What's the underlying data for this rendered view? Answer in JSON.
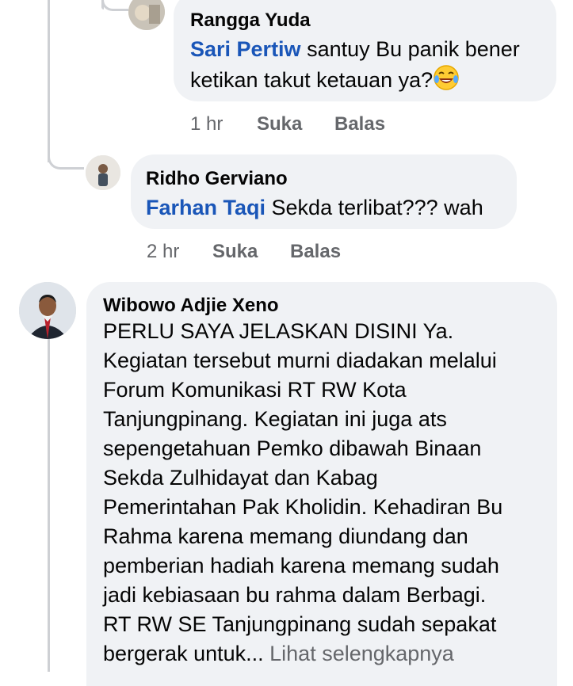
{
  "comments": [
    {
      "author": "Rangga Yuda",
      "mention": "Sari Pertiw",
      "text_line1": " santuy Bu panik bener",
      "text_line2": "ketikan takut ketauan ya?",
      "emoji": "rolling-on-floor-laughing-emoji",
      "time": "1 hr",
      "like": "Suka",
      "reply": "Balas"
    },
    {
      "author": "Ridho Gerviano",
      "mention": "Farhan Taqi",
      "text": " Sekda terlibat??? wah",
      "time": "2 hr",
      "like": "Suka",
      "reply": "Balas"
    },
    {
      "author": "Wibowo Adjie Xeno",
      "lines": [
        "PERLU SAYA JELASKAN DISINI Ya.",
        "Kegiatan tersebut murni diadakan melalui",
        "Forum Komunikasi RT RW Kota",
        "Tanjungpinang. Kegiatan ini juga ats",
        "sepengetahuan Pemko dibawah Binaan",
        "Sekda Zulhidayat dan Kabag",
        "Pemerintahan Pak Kholidin. Kehadiran Bu",
        "Rahma karena memang diundang dan",
        "pemberian hadiah karena memang sudah",
        "jadi kebiasaan bu rahma dalam Berbagi.",
        "RT RW SE Tanjungpinang sudah sepakat"
      ],
      "last_line": "bergerak untuk...",
      "see_more": "Lihat selengkapnya"
    }
  ],
  "colors": {
    "bubble": "#f0f2f5",
    "mention": "#1a56b8",
    "meta": "#65676b",
    "thread_line": "#ced0d4"
  }
}
